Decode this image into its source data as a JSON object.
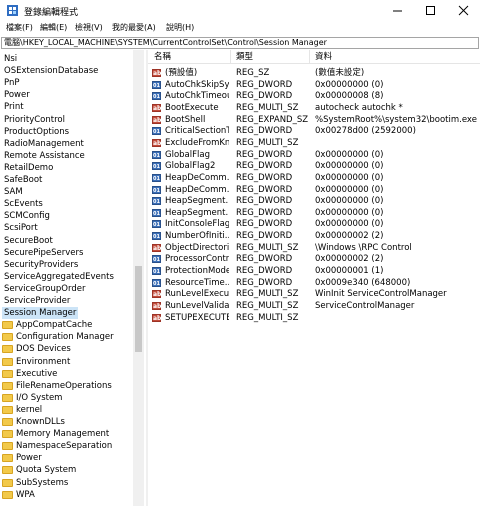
{
  "window": {
    "title": "登錄編輯程式",
    "icon": "regedit-icon"
  },
  "menu": [
    "檔案(F)",
    "編輯(E)",
    "檢視(V)",
    "我的最愛(A)",
    "說明(H)"
  ],
  "address": "電腦\\HKEY_LOCAL_MACHINE\\SYSTEM\\CurrentControlSet\\Control\\Session Manager",
  "tree": {
    "items": [
      {
        "label": "Nsi",
        "type": "key"
      },
      {
        "label": "OSExtensionDatabase",
        "type": "key"
      },
      {
        "label": "PnP",
        "type": "key"
      },
      {
        "label": "Power",
        "type": "key"
      },
      {
        "label": "Print",
        "type": "key"
      },
      {
        "label": "PriorityControl",
        "type": "key"
      },
      {
        "label": "ProductOptions",
        "type": "key"
      },
      {
        "label": "RadioManagement",
        "type": "key"
      },
      {
        "label": "Remote Assistance",
        "type": "key"
      },
      {
        "label": "RetailDemo",
        "type": "key"
      },
      {
        "label": "SafeBoot",
        "type": "key"
      },
      {
        "label": "SAM",
        "type": "key"
      },
      {
        "label": "ScEvents",
        "type": "key"
      },
      {
        "label": "SCMConfig",
        "type": "key"
      },
      {
        "label": "ScsiPort",
        "type": "key"
      },
      {
        "label": "SecureBoot",
        "type": "key"
      },
      {
        "label": "SecurePipeServers",
        "type": "key"
      },
      {
        "label": "SecurityProviders",
        "type": "key"
      },
      {
        "label": "ServiceAggregatedEvents",
        "type": "key"
      },
      {
        "label": "ServiceGroupOrder",
        "type": "key"
      },
      {
        "label": "ServiceProvider",
        "type": "key"
      },
      {
        "label": "Session Manager",
        "type": "key",
        "selected": true
      },
      {
        "label": "AppCompatCache",
        "type": "folder"
      },
      {
        "label": "Configuration Manager",
        "type": "folder"
      },
      {
        "label": "DOS Devices",
        "type": "folder"
      },
      {
        "label": "Environment",
        "type": "folder"
      },
      {
        "label": "Executive",
        "type": "folder"
      },
      {
        "label": "FileRenameOperations",
        "type": "folder"
      },
      {
        "label": "I/O System",
        "type": "folder"
      },
      {
        "label": "kernel",
        "type": "folder"
      },
      {
        "label": "KnownDLLs",
        "type": "folder"
      },
      {
        "label": "Memory Management",
        "type": "folder"
      },
      {
        "label": "NamespaceSeparation",
        "type": "folder"
      },
      {
        "label": "Power",
        "type": "folder"
      },
      {
        "label": "Quota System",
        "type": "folder"
      },
      {
        "label": "SubSystems",
        "type": "folder"
      },
      {
        "label": "WPA",
        "type": "folder"
      }
    ]
  },
  "list": {
    "columns": [
      "名稱",
      "類型",
      "資料"
    ],
    "rows": [
      {
        "name": "(預設值)",
        "type": "REG_SZ",
        "data": "(數值未設定)",
        "icon": "ab"
      },
      {
        "name": "AutoChkSkipSy...",
        "type": "REG_DWORD",
        "data": "0x00000000 (0)",
        "icon": "bin"
      },
      {
        "name": "AutoChkTimeout",
        "type": "REG_DWORD",
        "data": "0x00000008 (8)",
        "icon": "bin"
      },
      {
        "name": "BootExecute",
        "type": "REG_MULTI_SZ",
        "data": "autocheck autochk *",
        "icon": "ab"
      },
      {
        "name": "BootShell",
        "type": "REG_EXPAND_SZ",
        "data": "%SystemRoot%\\system32\\bootim.exe",
        "icon": "ab"
      },
      {
        "name": "CriticalSectionT...",
        "type": "REG_DWORD",
        "data": "0x00278d00 (2592000)",
        "icon": "bin"
      },
      {
        "name": "ExcludeFromKn...",
        "type": "REG_MULTI_SZ",
        "data": "",
        "icon": "ab"
      },
      {
        "name": "GlobalFlag",
        "type": "REG_DWORD",
        "data": "0x00000000 (0)",
        "icon": "bin"
      },
      {
        "name": "GlobalFlag2",
        "type": "REG_DWORD",
        "data": "0x00000000 (0)",
        "icon": "bin"
      },
      {
        "name": "HeapDeComm...",
        "type": "REG_DWORD",
        "data": "0x00000000 (0)",
        "icon": "bin"
      },
      {
        "name": "HeapDeComm...",
        "type": "REG_DWORD",
        "data": "0x00000000 (0)",
        "icon": "bin"
      },
      {
        "name": "HeapSegment...",
        "type": "REG_DWORD",
        "data": "0x00000000 (0)",
        "icon": "bin"
      },
      {
        "name": "HeapSegment...",
        "type": "REG_DWORD",
        "data": "0x00000000 (0)",
        "icon": "bin"
      },
      {
        "name": "InitConsoleFlags",
        "type": "REG_DWORD",
        "data": "0x00000000 (0)",
        "icon": "bin"
      },
      {
        "name": "NumberOfIniti...",
        "type": "REG_DWORD",
        "data": "0x00000002 (2)",
        "icon": "bin"
      },
      {
        "name": "ObjectDirectori...",
        "type": "REG_MULTI_SZ",
        "data": "\\Windows \\RPC Control",
        "icon": "ab"
      },
      {
        "name": "ProcessorControl",
        "type": "REG_DWORD",
        "data": "0x00000002 (2)",
        "icon": "bin"
      },
      {
        "name": "ProtectionMode",
        "type": "REG_DWORD",
        "data": "0x00000001 (1)",
        "icon": "bin"
      },
      {
        "name": "ResourceTime...",
        "type": "REG_DWORD",
        "data": "0x0009e340 (648000)",
        "icon": "bin"
      },
      {
        "name": "RunLevelExecute",
        "type": "REG_MULTI_SZ",
        "data": "WinInit ServiceControlManager",
        "icon": "ab"
      },
      {
        "name": "RunLevelValida...",
        "type": "REG_MULTI_SZ",
        "data": "ServiceControlManager",
        "icon": "ab"
      },
      {
        "name": "SETUPEXECUTE",
        "type": "REG_MULTI_SZ",
        "data": "",
        "icon": "ab"
      }
    ]
  },
  "colors": {
    "selection": "#cce4f7",
    "folder": "#f2c94a",
    "sz_icon": "#c24b3a",
    "bin_icon": "#3b6fb8"
  }
}
